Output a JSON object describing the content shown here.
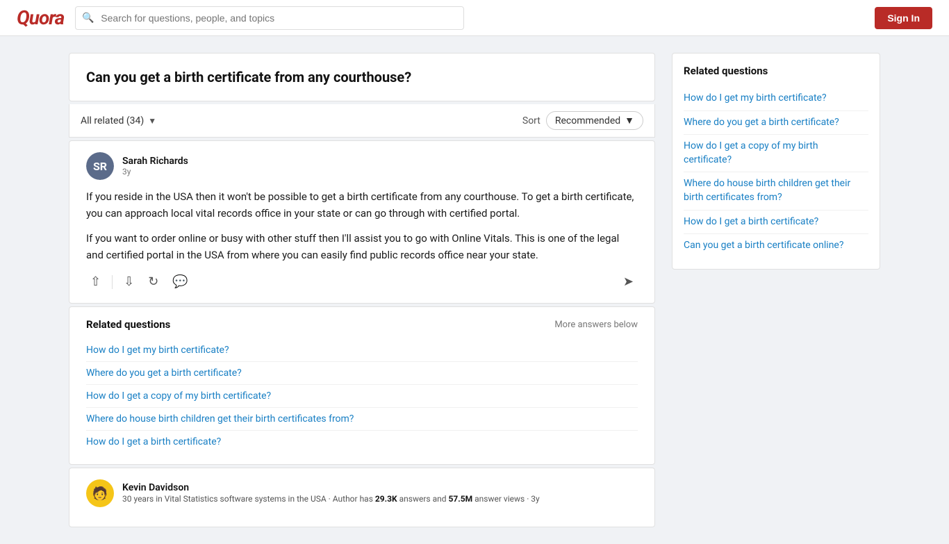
{
  "header": {
    "logo": "Quora",
    "search_placeholder": "Search for questions, people, and topics",
    "sign_in_label": "Sign In"
  },
  "page": {
    "question_title": "Can you get a birth certificate from any courthouse?",
    "sort_bar": {
      "all_related": "All related (34)",
      "sort_label": "Sort",
      "sort_value": "Recommended"
    },
    "answers": [
      {
        "id": "answer-1",
        "author_name": "Sarah Richards",
        "author_time": "3y",
        "avatar_initials": "SR",
        "paragraphs": [
          "If you reside in the USA then it won't be possible to get a birth certificate from any courthouse. To get a birth certificate, you can approach local vital records office in your state or can go through with certified portal.",
          "If you want to order online or busy with other stuff then I'll assist you to go with Online Vitals. This is one of the legal and certified portal in the USA from where you can easily find public records office near your state."
        ]
      }
    ],
    "related_inline": {
      "title": "Related questions",
      "more_answers": "More answers below",
      "links": [
        "How do I get my birth certificate?",
        "Where do you get a birth certificate?",
        "How do I get a copy of my birth certificate?",
        "Where do house birth children get their birth certificates from?",
        "How do I get a birth certificate?"
      ]
    },
    "answer2": {
      "author_name": "Kevin Davidson",
      "author_bio": "30 years in Vital Statistics software systems in the USA · Author has",
      "answers_count": "29.3K",
      "answers_label": "answers and",
      "views_count": "57.5M",
      "views_label": "answer views · 3y"
    }
  },
  "sidebar": {
    "title": "Related questions",
    "links": [
      "How do I get my birth certificate?",
      "Where do you get a birth certificate?",
      "How do I get a copy of my birth certificate?",
      "Where do house birth children get their birth certificates from?",
      "How do I get a birth certificate?",
      "Can you get a birth certificate online?"
    ]
  }
}
